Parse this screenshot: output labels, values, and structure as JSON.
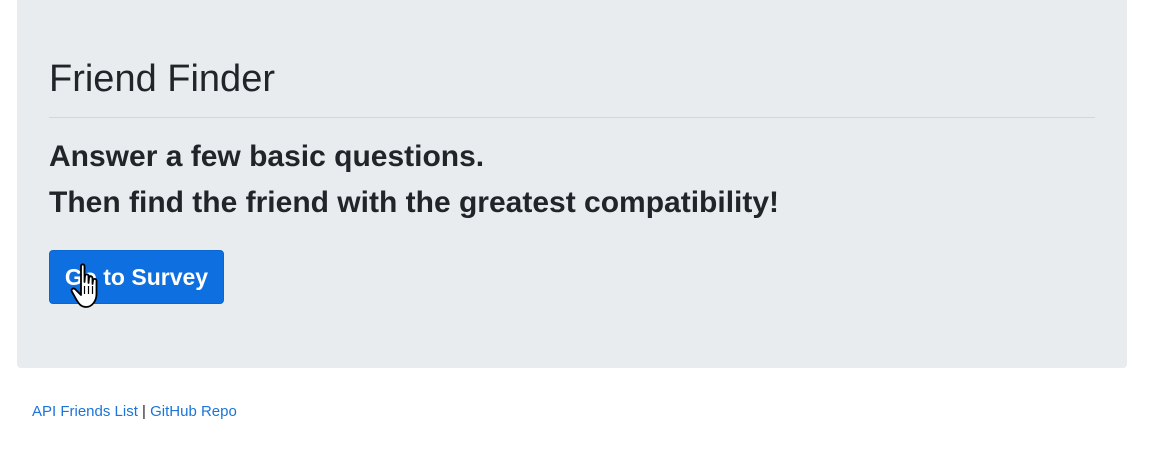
{
  "jumbotron": {
    "title": "Friend Finder",
    "lead_line_1": "Answer a few basic questions.",
    "lead_line_2": "Then find the friend with the greatest compatibility!",
    "button_label": "Go to Survey"
  },
  "footer": {
    "link_1": "API Friends List",
    "separator": "|",
    "link_2": "GitHub Repo"
  },
  "colors": {
    "jumbotron_bg": "#e9ecef",
    "button_bg": "#0d6fe0",
    "link": "#1b74d8",
    "text": "#212529"
  },
  "cursor": {
    "icon": "hand-pointer-icon"
  }
}
